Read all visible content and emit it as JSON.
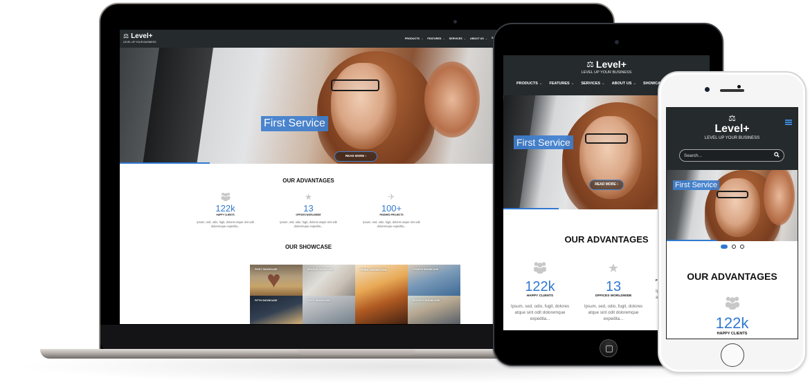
{
  "site": {
    "brand": "Level+",
    "tagline": "LEVEL UP YOUR BUSINESS",
    "logo_icon": "scale-icon",
    "accent_color": "#2f78d0",
    "header_color": "#252a2c"
  },
  "laptop": {
    "nav": [
      "PRODUCTS",
      "FEATURES",
      "SERVICES",
      "ABOUT US",
      "SHC"
    ],
    "hero": {
      "caption": "First Service",
      "button": "READ MORE"
    },
    "advantages_title": "OUR ADVANTAGES",
    "advantages": [
      {
        "icon": "users-icon",
        "number": "122k",
        "label": "HAPPY CLIENTS",
        "desc": "Ipsum, sed, odio, fugit, dolores atque sint odit doloremque expedita..."
      },
      {
        "icon": "star-icon",
        "number": "13",
        "label": "OFFICES WORLDWIDE",
        "desc": "Ipsum, sed, odio, fugit, dolores atque sint odit doloremque expedita..."
      },
      {
        "icon": "plane-icon",
        "number": "100+",
        "label": "FINISHED PROJECTS",
        "desc": "Ipsum, sed, odio, fugit, dolores atque sint odit doloremque expedita..."
      }
    ],
    "showcase_title": "OUR SHOWCASE",
    "showcase": [
      "FIRST SHOWCASE",
      "SECOND SHOWCASE",
      "THIRD SHOWCASE",
      "FOURTH SHOWCASE",
      "FIFTH SHOWCASE",
      "SIXTH SHOWCASE",
      "SEVENTH SHOWCASE"
    ]
  },
  "tablet": {
    "nav": [
      "PRODUCTS",
      "FEATURES",
      "SERVICES",
      "ABOUT US",
      "SHOWCASE"
    ],
    "hero": {
      "caption": "First Service",
      "button": "READ MORE"
    },
    "advantages_title": "OUR ADVANTAGES",
    "advantages": [
      {
        "number": "122k",
        "label": "HAPPY CLIENTS",
        "desc": "Ipsum, sed, odio, fugit, dolores atque sint odit doloremque expedita..."
      },
      {
        "number": "13",
        "label": "OFFICES WORLDWIDE",
        "desc": "Ipsum, sed, odio, fugit, dolores atque sint odit doloremque expedita..."
      },
      {
        "number": "",
        "label": "F",
        "desc": "Ipsum atqu"
      }
    ]
  },
  "phone": {
    "search_placeholder": "Search...",
    "hero": {
      "caption": "First Service"
    },
    "slider_dots": {
      "count": 3,
      "active": 1
    },
    "advantages_title": "OUR ADVANTAGES",
    "advantages": [
      {
        "number": "122k",
        "label": "HAPPY CLIENTS"
      }
    ]
  },
  "icons": {
    "scale": "⚖",
    "users": "●●●",
    "star": "★",
    "plane": "✈",
    "search": "⚲",
    "chevron_down": "⌄",
    "chevron_right": "›"
  }
}
